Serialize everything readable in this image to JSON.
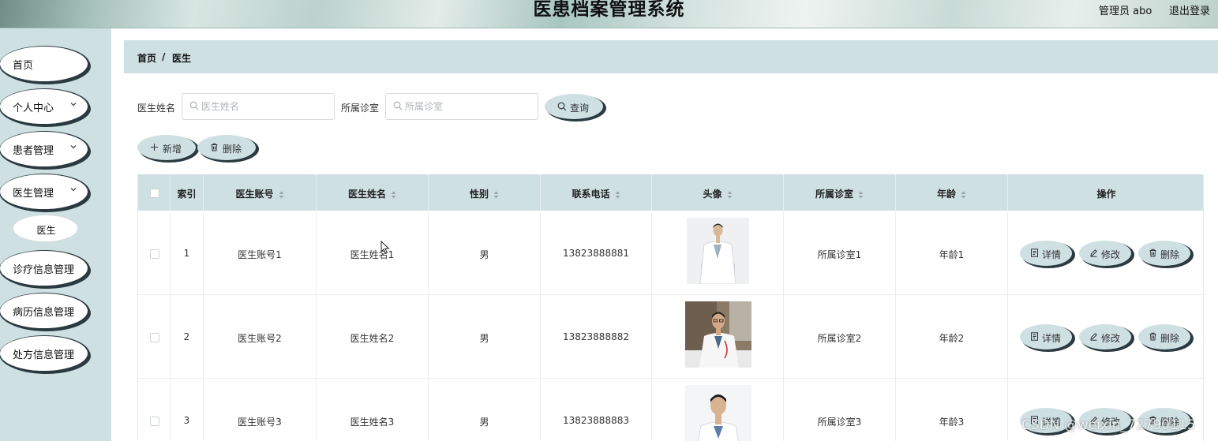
{
  "header": {
    "title": "医患档案管理系统",
    "user": "管理员 abo",
    "logout": "退出登录"
  },
  "sidebar": {
    "items": [
      {
        "label": "首页",
        "has_submenu": false
      },
      {
        "label": "个人中心",
        "has_submenu": true
      },
      {
        "label": "患者管理",
        "has_submenu": true
      },
      {
        "label": "医生管理",
        "has_submenu": true
      },
      {
        "label": "诊疗信息管理",
        "has_submenu": false
      },
      {
        "label": "病历信息管理",
        "has_submenu": false
      },
      {
        "label": "处方信息管理",
        "has_submenu": false
      }
    ],
    "sub_item": "医生"
  },
  "breadcrumb": {
    "home": "首页",
    "separator": "/",
    "current": "医生"
  },
  "search": {
    "name_label": "医生姓名",
    "name_placeholder": "医生姓名",
    "name_value": "",
    "clinic_label": "所属诊室",
    "clinic_placeholder": "所属诊室",
    "clinic_value": "",
    "query_button": "查询"
  },
  "toolbar": {
    "add_button": "新增",
    "delete_button": "删除"
  },
  "table": {
    "headers": {
      "index": "索引",
      "account": "医生账号",
      "name": "医生姓名",
      "gender": "性别",
      "phone": "联系电话",
      "avatar": "头像",
      "clinic": "所属诊室",
      "age": "年龄",
      "actions": "操作"
    },
    "rows": [
      {
        "index": "1",
        "account": "医生账号1",
        "name": "医生姓名1",
        "gender": "男",
        "phone": "13823888881",
        "clinic": "所属诊室1",
        "age": "年龄1"
      },
      {
        "index": "2",
        "account": "医生账号2",
        "name": "医生姓名2",
        "gender": "男",
        "phone": "13823888882",
        "clinic": "所属诊室2",
        "age": "年龄2"
      },
      {
        "index": "3",
        "account": "医生账号3",
        "name": "医生姓名3",
        "gender": "男",
        "phone": "13823888883",
        "clinic": "所属诊室3",
        "age": "年龄3"
      }
    ],
    "actions": {
      "detail": "详情",
      "edit": "修改",
      "delete": "删除"
    }
  },
  "watermark": "CSDN @weixin_72790115",
  "colors": {
    "panel": "#cfe0e3",
    "shadow": "#2b3a40",
    "sidebar_bg": "#cfe0e3"
  }
}
